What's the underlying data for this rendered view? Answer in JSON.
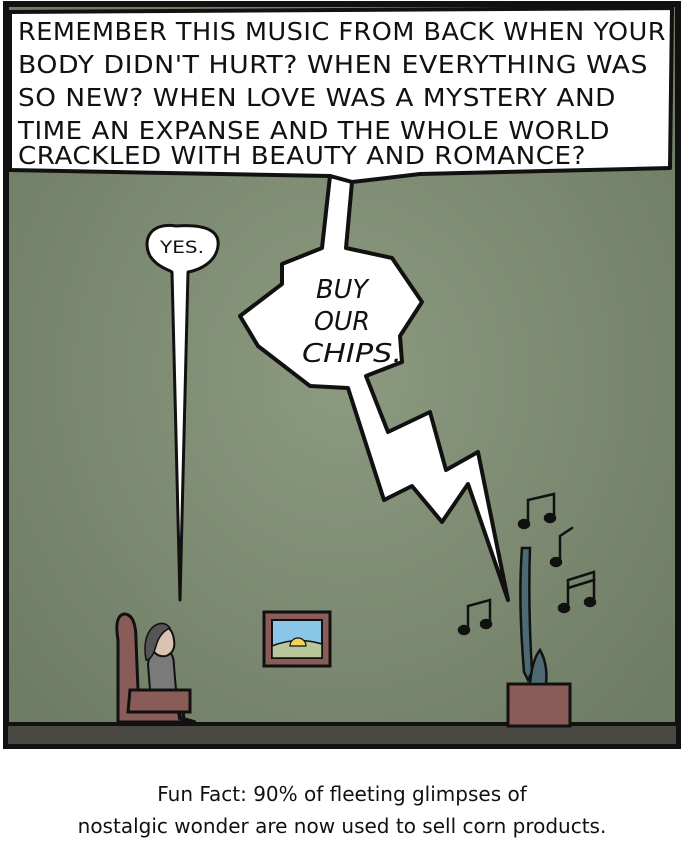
{
  "comic": {
    "top_bubble": [
      "REMEMBER THIS MUSIC FROM BACK WHEN YOUR",
      "BODY DIDN'T HURT? WHEN EVERYTHING WAS",
      "SO NEW? WHEN LOVE WAS A MYSTERY AND",
      "TIME AN EXPANSE AND THE WHOLE WORLD",
      "CRACKLED WITH BEAUTY AND ROMANCE?"
    ],
    "person_reply": "YES.",
    "tv_lines": [
      "BUY",
      "OUR",
      "CHIPS."
    ]
  },
  "caption": {
    "line1": "Fun Fact: 90% of fleeting glimpses of",
    "line2": "nostalgic wonder are now used to sell corn products."
  },
  "colors": {
    "wall": "#7c8a70",
    "floor": "#4a4843",
    "chair": "#8a5c58",
    "tv_stand": "#8a5c58",
    "tv_screen": "#4d6a74",
    "frame": "#8a5c58",
    "sky": "#8ac6e8"
  }
}
